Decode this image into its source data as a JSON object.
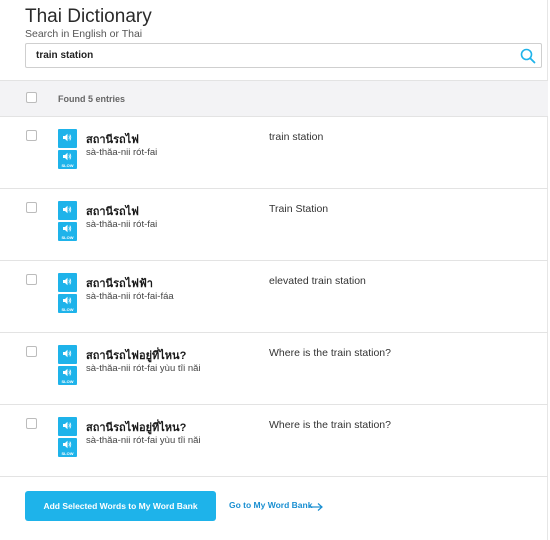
{
  "header": {
    "title": "Thai Dictionary",
    "subtitle": "Search in English or Thai"
  },
  "search": {
    "value": "train station",
    "icon": "search-icon"
  },
  "results": {
    "count_label": "Found 5 entries",
    "slow_label": "SLOW",
    "entries": [
      {
        "thai": "สถานีรถไฟ",
        "translit": "sà-thăa-nii rót-fai",
        "meaning": "train station"
      },
      {
        "thai": "สถานีรถไฟ",
        "translit": "sà-thăa-nii rót-fai",
        "meaning": "Train Station"
      },
      {
        "thai": "สถานีรถไฟฟ้า",
        "translit": "sà-thăa-nii rót-fai-fáa",
        "meaning": "elevated train station"
      },
      {
        "thai": "สถานีรถไฟอยู่ที่ไหน?",
        "translit": "sà-thăa-nii rót-fai yùu tîi năi",
        "meaning": "Where is the train station?"
      },
      {
        "thai": "สถานีรถไฟอยู่ที่ไหน?",
        "translit": "sà-thăa-nii rót-fai yùu tîi năi",
        "meaning": "Where is the train station?"
      }
    ]
  },
  "footer": {
    "add_button": "Add Selected Words to My Word Bank",
    "goto_link": "Go to My Word Bank"
  },
  "colors": {
    "accent": "#1eb3ea",
    "link": "#1a8fd1"
  }
}
